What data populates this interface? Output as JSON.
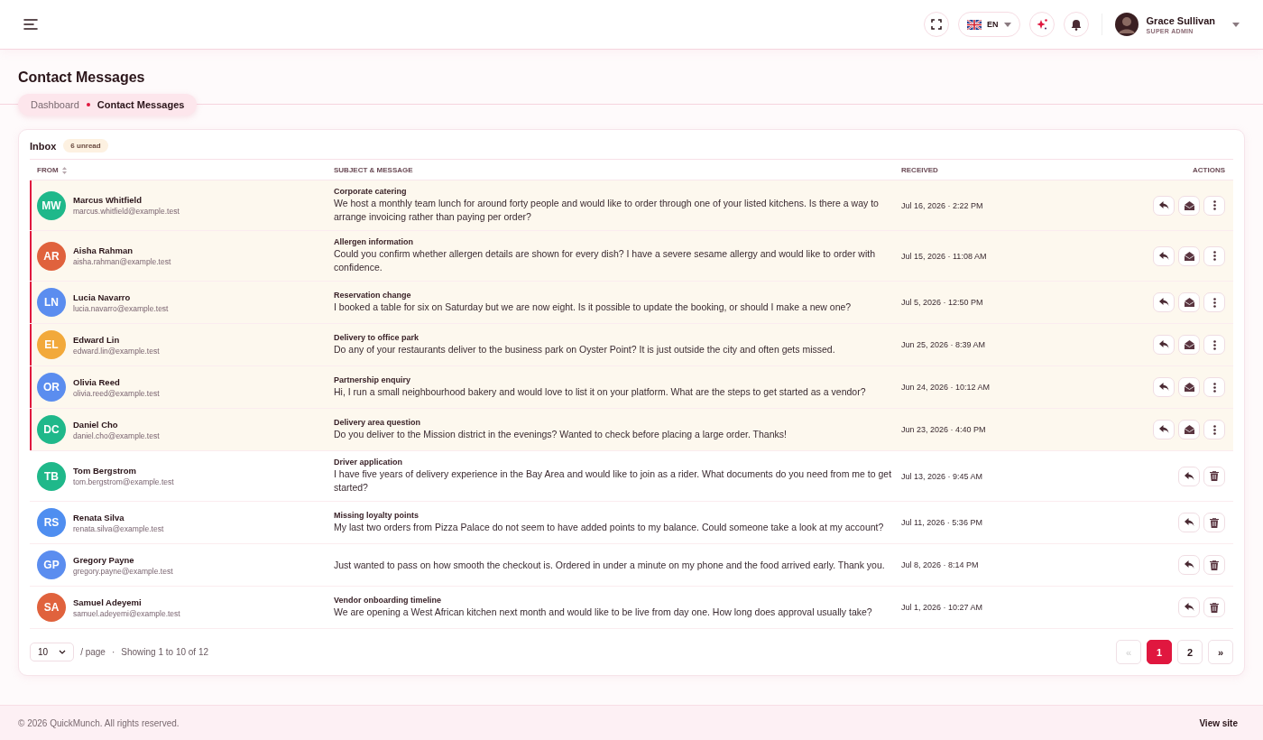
{
  "topbar": {
    "language": "EN",
    "user": {
      "name": "Grace Sullivan",
      "role": "SUPER ADMIN"
    }
  },
  "page": {
    "title": "Contact Messages",
    "breadcrumb": [
      {
        "label": "Dashboard",
        "current": false
      },
      {
        "label": "Contact Messages",
        "current": true
      }
    ]
  },
  "inbox": {
    "title": "Inbox",
    "unread_badge": "6 unread",
    "columns": [
      {
        "label": "FROM",
        "sortable": true
      },
      {
        "label": "SUBJECT & MESSAGE",
        "sortable": false
      },
      {
        "label": "RECEIVED",
        "sortable": false
      },
      {
        "label": "ACTIONS",
        "sortable": false
      }
    ],
    "rows": [
      {
        "initials": "MW",
        "color": "#1fb88a",
        "name": "Marcus Whitfield",
        "email": "marcus.whitfield@example.test",
        "subject": "Corporate catering",
        "message": "We host a monthly team lunch for around forty people and would like to order through one of your listed kitchens. Is there a way to arrange invoicing rather than paying per order?",
        "received": "Jul 16, 2026 · 2:22 PM",
        "unread": true,
        "actions": [
          {
            "kind": "reply"
          },
          {
            "kind": "mark-read"
          },
          {
            "kind": "more"
          }
        ]
      },
      {
        "initials": "AR",
        "color": "#e0623d",
        "name": "Aisha Rahman",
        "email": "aisha.rahman@example.test",
        "subject": "Allergen information",
        "message": "Could you confirm whether allergen details are shown for every dish? I have a severe sesame allergy and would like to order with confidence.",
        "received": "Jul 15, 2026 · 11:08 AM",
        "unread": true,
        "actions": [
          {
            "kind": "reply"
          },
          {
            "kind": "mark-read"
          },
          {
            "kind": "more"
          }
        ]
      },
      {
        "initials": "LN",
        "color": "#5b8def",
        "name": "Lucia Navarro",
        "email": "lucia.navarro@example.test",
        "subject": "Reservation change",
        "message": "I booked a table for six on Saturday but we are now eight. Is it possible to update the booking, or should I make a new one?",
        "received": "Jul 5, 2026 · 12:50 PM",
        "unread": true,
        "actions": [
          {
            "kind": "reply"
          },
          {
            "kind": "mark-read"
          },
          {
            "kind": "more"
          }
        ]
      },
      {
        "initials": "EL",
        "color": "#f2a93b",
        "name": "Edward Lin",
        "email": "edward.lin@example.test",
        "subject": "Delivery to office park",
        "message": "Do any of your restaurants deliver to the business park on Oyster Point? It is just outside the city and often gets missed.",
        "received": "Jun 25, 2026 · 8:39 AM",
        "unread": true,
        "actions": [
          {
            "kind": "reply"
          },
          {
            "kind": "mark-read"
          },
          {
            "kind": "more"
          }
        ]
      },
      {
        "initials": "OR",
        "color": "#5b8def",
        "name": "Olivia Reed",
        "email": "olivia.reed@example.test",
        "subject": "Partnership enquiry",
        "message": "Hi, I run a small neighbourhood bakery and would love to list it on your platform. What are the steps to get started as a vendor?",
        "received": "Jun 24, 2026 · 10:12 AM",
        "unread": true,
        "actions": [
          {
            "kind": "reply"
          },
          {
            "kind": "mark-read"
          },
          {
            "kind": "more"
          }
        ]
      },
      {
        "initials": "DC",
        "color": "#1fb88a",
        "name": "Daniel Cho",
        "email": "daniel.cho@example.test",
        "subject": "Delivery area question",
        "message": "Do you deliver to the Mission district in the evenings? Wanted to check before placing a large order. Thanks!",
        "received": "Jun 23, 2026 · 4:40 PM",
        "unread": true,
        "actions": [
          {
            "kind": "reply"
          },
          {
            "kind": "mark-read"
          },
          {
            "kind": "more"
          }
        ]
      },
      {
        "initials": "TB",
        "color": "#1fb88a",
        "name": "Tom Bergstrom",
        "email": "tom.bergstrom@example.test",
        "subject": "Driver application",
        "message": "I have five years of delivery experience in the Bay Area and would like to join as a rider. What documents do you need from me to get started?",
        "received": "Jul 13, 2026 · 9:45 AM",
        "unread": false,
        "actions": [
          {
            "kind": "reply"
          },
          {
            "kind": "delete"
          }
        ]
      },
      {
        "initials": "RS",
        "color": "#4f8ef0",
        "name": "Renata Silva",
        "email": "renata.silva@example.test",
        "subject": "Missing loyalty points",
        "message": "My last two orders from Pizza Palace do not seem to have added points to my balance. Could someone take a look at my account?",
        "received": "Jul 11, 2026 · 5:36 PM",
        "unread": false,
        "actions": [
          {
            "kind": "reply"
          },
          {
            "kind": "delete"
          }
        ]
      },
      {
        "initials": "GP",
        "color": "#5b8def",
        "name": "Gregory Payne",
        "email": "gregory.payne@example.test",
        "message": "Just wanted to pass on how smooth the checkout is. Ordered in under a minute on my phone and the food arrived early. Thank you.",
        "received": "Jul 8, 2026 · 8:14 PM",
        "unread": false,
        "actions": [
          {
            "kind": "reply"
          },
          {
            "kind": "delete"
          }
        ]
      },
      {
        "initials": "SA",
        "color": "#e0623d",
        "name": "Samuel Adeyemi",
        "email": "samuel.adeyemi@example.test",
        "subject": "Vendor onboarding timeline",
        "message": "We are opening a West African kitchen next month and would like to be live from day one. How long does approval usually take?",
        "received": "Jul 1, 2026 · 10:27 AM",
        "unread": false,
        "actions": [
          {
            "kind": "reply"
          },
          {
            "kind": "delete"
          }
        ]
      }
    ],
    "pagination": {
      "per_page": "10",
      "per_page_label": "/ page",
      "separator": "·",
      "summary": "Showing 1 to 10 of 12",
      "pages": [
        {
          "label": "«",
          "selected": false,
          "disabled": true
        },
        {
          "label": "1",
          "selected": true,
          "disabled": false
        },
        {
          "label": "2",
          "selected": false,
          "disabled": false
        },
        {
          "label": "»",
          "selected": false,
          "disabled": false
        }
      ]
    }
  },
  "footer": {
    "copyright": "© 2026 QuickMunch. All rights reserved.",
    "link": "View site"
  }
}
